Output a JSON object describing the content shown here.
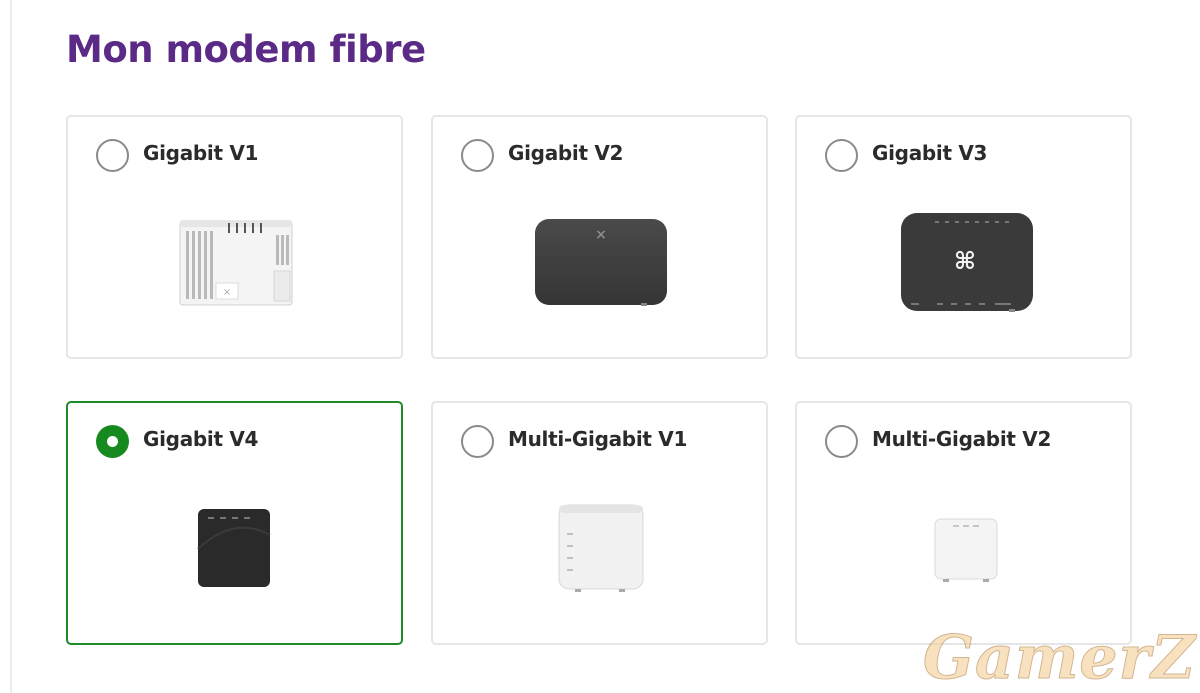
{
  "page": {
    "title": "Mon modem fibre"
  },
  "options": [
    {
      "label": "Gigabit V1",
      "selected": false,
      "device_icon": "modem-gigabit-v1"
    },
    {
      "label": "Gigabit V2",
      "selected": false,
      "device_icon": "modem-gigabit-v2"
    },
    {
      "label": "Gigabit V3",
      "selected": false,
      "device_icon": "modem-gigabit-v3"
    },
    {
      "label": "Gigabit V4",
      "selected": true,
      "device_icon": "modem-gigabit-v4"
    },
    {
      "label": "Multi-Gigabit V1",
      "selected": false,
      "device_icon": "modem-multi-gigabit-v1"
    },
    {
      "label": "Multi-Gigabit V2",
      "selected": false,
      "device_icon": "modem-multi-gigabit-v2"
    }
  ],
  "watermark": "GamerZ",
  "colors": {
    "title": "#5b2a86",
    "selected_accent": "#168a1e",
    "card_border": "#e6e6e6"
  }
}
